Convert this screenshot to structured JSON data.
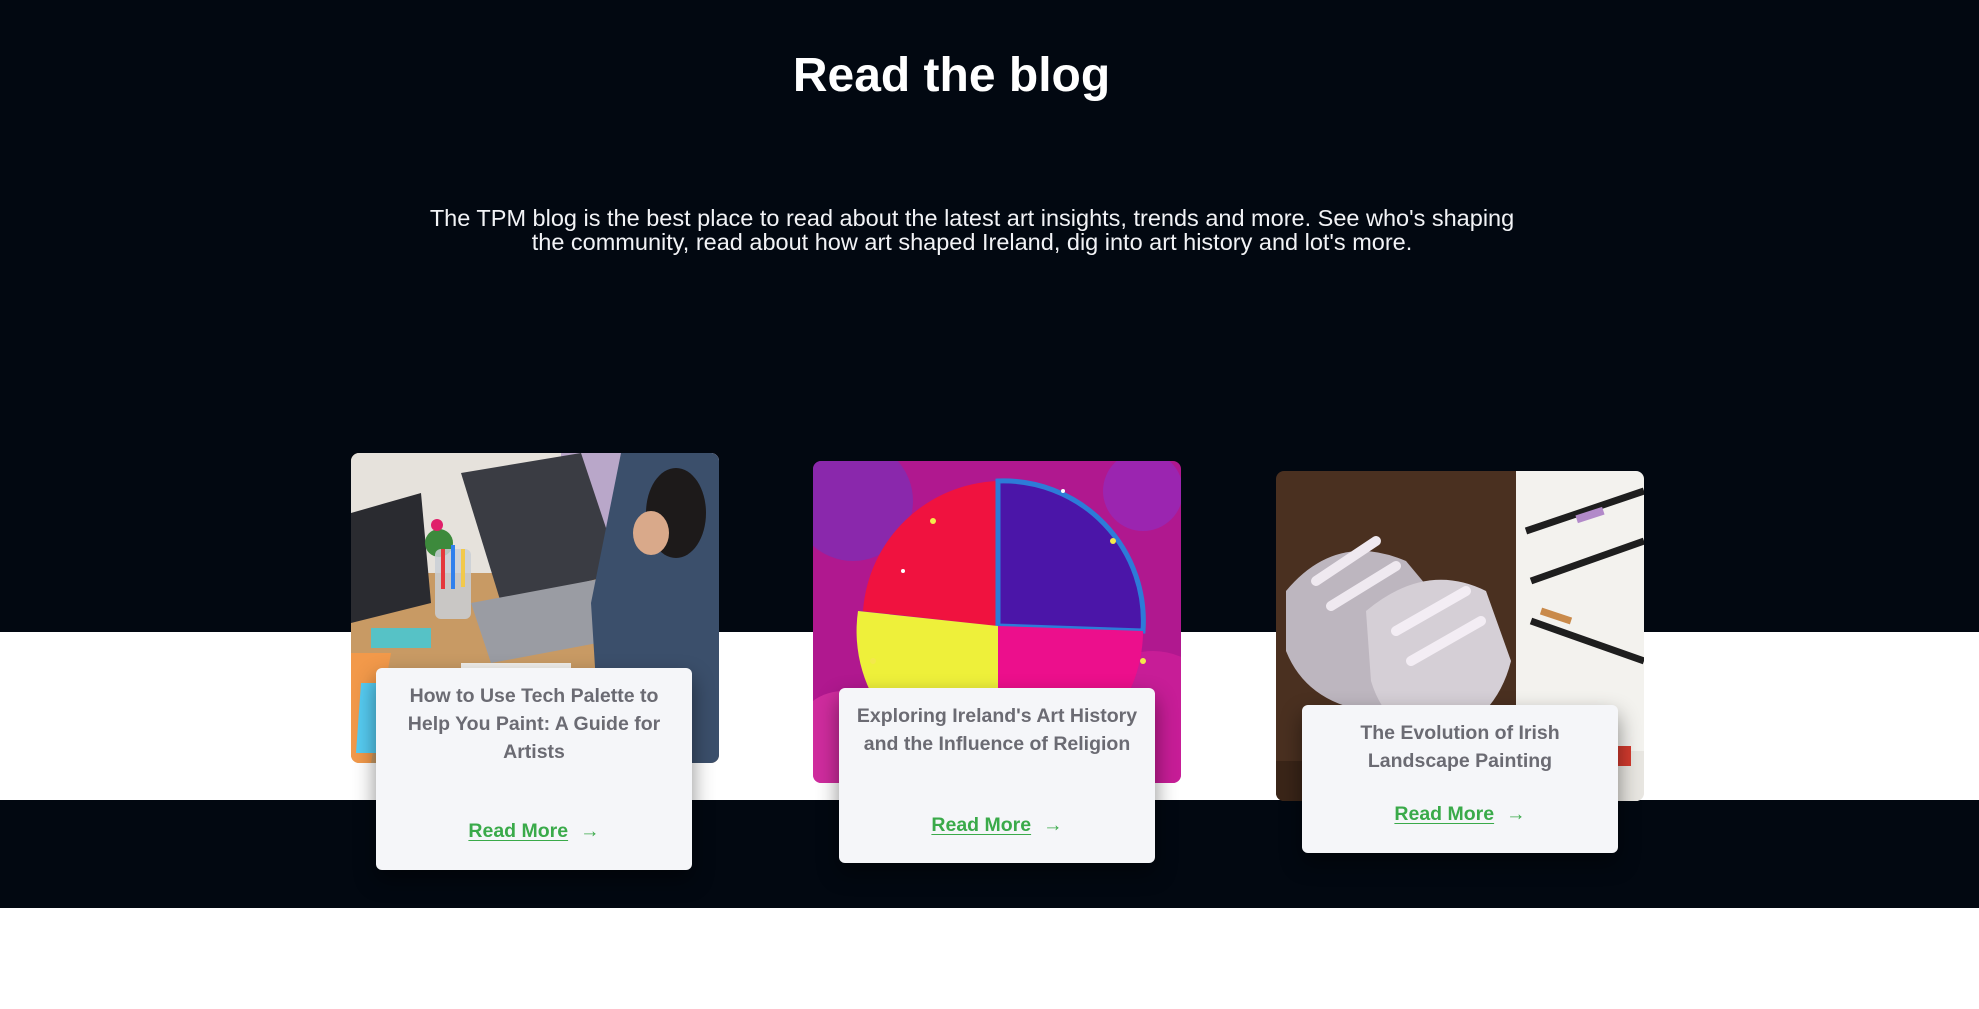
{
  "section": {
    "title": "Read the blog",
    "intro": "The TPM blog is the best place to read about the latest art insights, trends and more. See who's shaping the community, read about how art shaped Ireland, dig into art history and lot's more."
  },
  "posts": [
    {
      "title": "How to Use Tech Palette to Help You Paint: A Guide for Artists",
      "read_more": "Read More",
      "arrow": "→"
    },
    {
      "title": "Exploring Ireland's Art History and the Influence of Religion",
      "read_more": "Read More",
      "arrow": "→"
    },
    {
      "title": "The Evolution of Irish Landscape Painting",
      "read_more": "Read More",
      "arrow": "→"
    }
  ],
  "colors": {
    "dark_band": "#020811",
    "card_bg": "#f5f6f9",
    "card_title": "#6b6b73",
    "link": "#3aaa4a"
  }
}
